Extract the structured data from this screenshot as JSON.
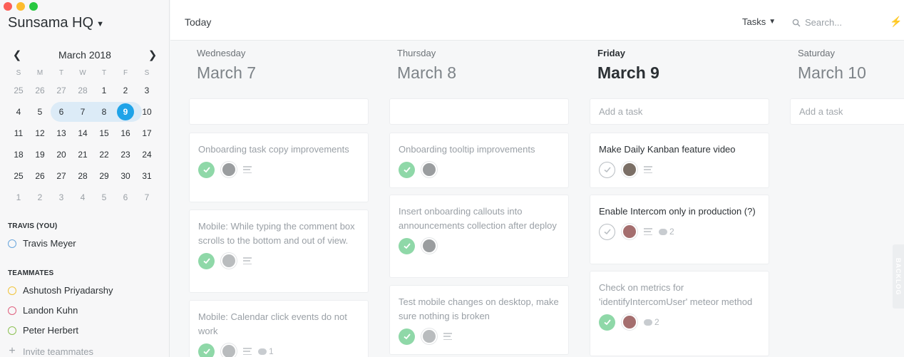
{
  "workspace": {
    "name": "Sunsama HQ"
  },
  "calendar": {
    "month_label": "March 2018",
    "weekdays": [
      "S",
      "M",
      "T",
      "W",
      "T",
      "F",
      "S"
    ],
    "weeks": [
      [
        "25",
        "26",
        "27",
        "28",
        "1",
        "2",
        "3"
      ],
      [
        "4",
        "5",
        "6",
        "7",
        "8",
        "9",
        "10"
      ],
      [
        "11",
        "12",
        "13",
        "14",
        "15",
        "16",
        "17"
      ],
      [
        "18",
        "19",
        "20",
        "21",
        "22",
        "23",
        "24"
      ],
      [
        "25",
        "26",
        "27",
        "28",
        "29",
        "30",
        "31"
      ],
      [
        "1",
        "2",
        "3",
        "4",
        "5",
        "6",
        "7"
      ]
    ],
    "today": "9"
  },
  "people": {
    "you_label": "TRAVIS (YOU)",
    "you": {
      "name": "Travis Meyer",
      "color": "#6aa6dc"
    },
    "teammates_label": "TEAMMATES",
    "teammates": [
      {
        "name": "Ashutosh Priyadarshy",
        "color": "#f0c43a"
      },
      {
        "name": "Landon Kuhn",
        "color": "#e0607e"
      },
      {
        "name": "Peter Herbert",
        "color": "#8cc152"
      }
    ],
    "invite_label": "Invite teammates"
  },
  "topbar": {
    "title": "Today",
    "view_select": "Tasks",
    "search_placeholder": "Search..."
  },
  "columns": [
    {
      "day": "Wednesday",
      "date": "March 7",
      "add_placeholder": "",
      "tasks": [
        {
          "title": "Onboarding task copy improvements",
          "done": true,
          "comments": ""
        },
        {
          "title": "Mobile: While typing the comment box scrolls to the bottom and out of view.",
          "done": true,
          "comments": ""
        },
        {
          "title": "Mobile: Calendar click events do not work",
          "done": true,
          "comments": "1"
        }
      ]
    },
    {
      "day": "Thursday",
      "date": "March 8",
      "add_placeholder": "",
      "tasks": [
        {
          "title": "Onboarding tooltip improvements",
          "done": true,
          "comments": ""
        },
        {
          "title": "Insert onboarding callouts into announcements collection after deploy",
          "done": true,
          "comments": ""
        },
        {
          "title": "Test mobile changes on desktop, make sure nothing is broken",
          "done": true,
          "comments": ""
        }
      ]
    },
    {
      "day": "Friday",
      "date": "March 9",
      "add_placeholder": "Add a task",
      "tasks": [
        {
          "title": "Make Daily Kanban feature video",
          "done": false,
          "comments": ""
        },
        {
          "title": "Enable Intercom only in production (?)",
          "done": false,
          "comments": "2"
        },
        {
          "title": "Check on metrics for 'identifyIntercomUser' meteor method",
          "done": true,
          "comments": "2"
        }
      ]
    },
    {
      "day": "Saturday",
      "date": "March 10",
      "add_placeholder": "Add a task",
      "tasks": []
    }
  ],
  "backlog_label": "BACKLOG"
}
